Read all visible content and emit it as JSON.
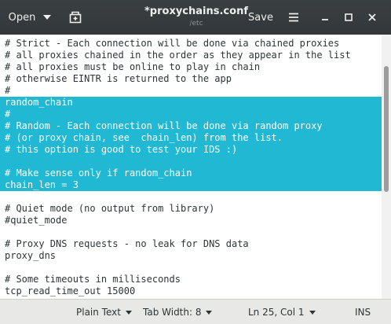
{
  "header": {
    "open_label": "Open",
    "title": "*proxychains.conf",
    "subtitle": "/etc",
    "save_label": "Save"
  },
  "editor": {
    "lines": [
      "#",
      "# Strict - Each connection will be done via chained proxies",
      "# all proxies chained in the order as they appear in the list",
      "# all proxies must be online to play in chain",
      "# otherwise EINTR is returned to the app",
      "#",
      "random_chain",
      "#",
      "# Random - Each connection will be done via random proxy",
      "# (or proxy chain, see  chain_len) from the list.",
      "# this option is good to test your IDS :)",
      "",
      "# Make sense only if random_chain",
      "chain_len = 3",
      "",
      "# Quiet mode (no output from library)",
      "#quiet_mode",
      "",
      "# Proxy DNS requests - no leak for DNS data",
      "proxy_dns",
      "",
      "# Some timeouts in milliseconds",
      "tcp_read_time_out 15000"
    ],
    "selection_color": "#21b8d3"
  },
  "statusbar": {
    "language": "Plain Text",
    "tab_width": "Tab Width: 8",
    "position": "Ln 25, Col 1",
    "mode": "INS"
  }
}
